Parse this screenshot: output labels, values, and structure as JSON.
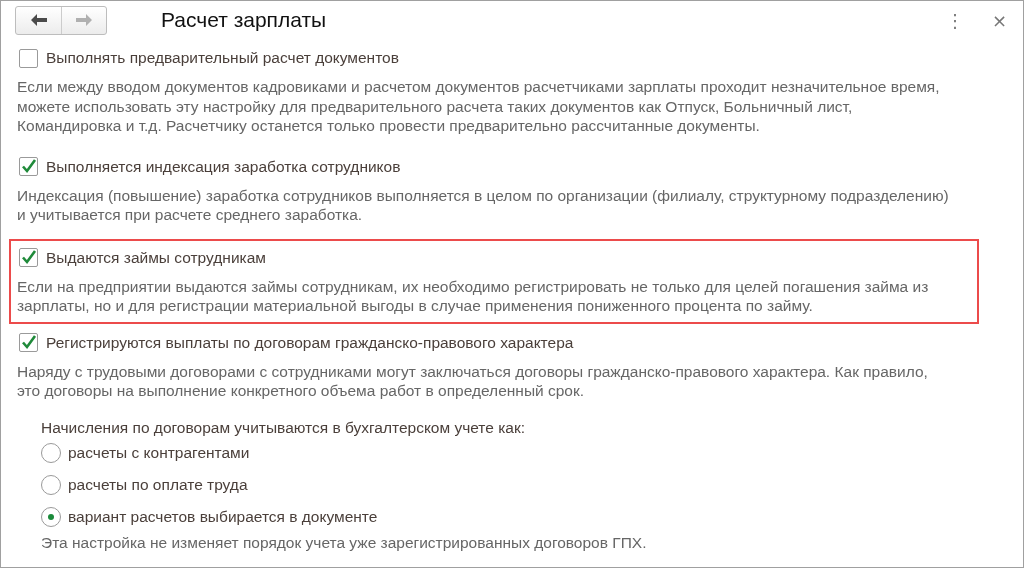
{
  "window": {
    "title": "Расчет зарплаты",
    "menu_button": "⋮",
    "close_button": "×"
  },
  "sections": [
    {
      "label": "Выполнять предварительный расчет документов",
      "checked": false,
      "highlighted": false,
      "description": "Если между вводом документов кадровиками и расчетом документов расчетчиками зарплаты проходит незначительное время, можете использовать эту настройку для предварительного расчета таких документов как Отпуск, Больничный лист, Командировка и т.д. Расчетчику останется только провести предварительно рассчитанные документы."
    },
    {
      "label": "Выполняется индексация заработка сотрудников",
      "checked": true,
      "highlighted": false,
      "description": "Индексация (повышение) заработка сотрудников выполняется в целом по организации (филиалу, структурному подразделению) и учитывается при расчете среднего заработка."
    },
    {
      "label": "Выдаются займы сотрудникам",
      "checked": true,
      "highlighted": true,
      "description": "Если на предприятии выдаются займы сотрудникам, их необходимо регистрировать не только для целей погашения займа из зарплаты, но и для регистрации материальной выгоды в случае применения пониженного процента по займу."
    },
    {
      "label": "Регистрируются выплаты по договорам гражданско-правового характера",
      "checked": true,
      "highlighted": false,
      "description": "Наряду с трудовыми договорами с сотрудниками могут заключаться договоры гражданско-правового характера. Как правило, это договоры на выполнение конкретного объема работ в определенный срок."
    }
  ],
  "accounting_option": {
    "caption": "Начисления по договорам учитываются в бухгалтерском учете как:",
    "options": [
      {
        "label": "расчеты с контрагентами",
        "selected": false
      },
      {
        "label": "расчеты по оплате труда",
        "selected": false
      },
      {
        "label": "вариант расчетов выбирается в документе",
        "selected": true
      }
    ],
    "note": "Эта настройка не изменяет порядок учета уже зарегистрированных договоров ГПХ."
  }
}
